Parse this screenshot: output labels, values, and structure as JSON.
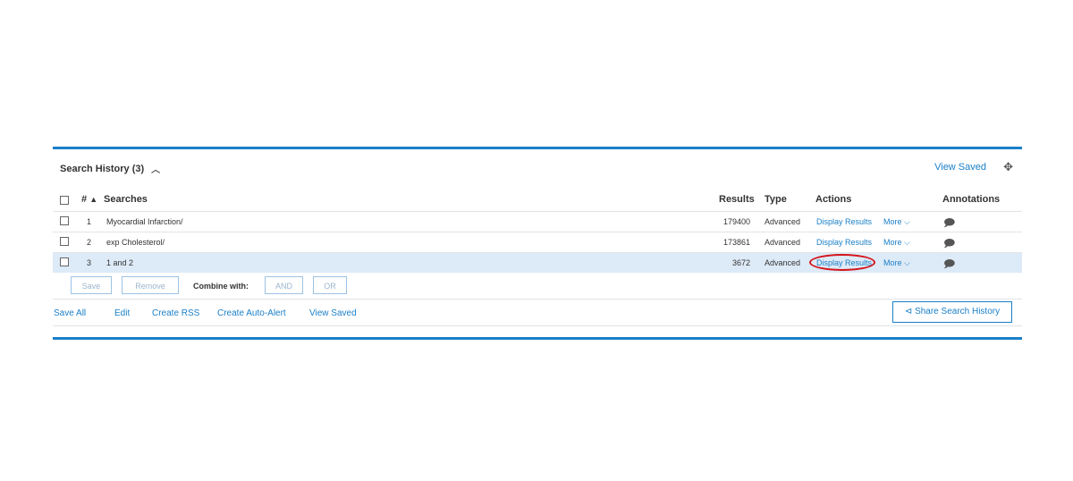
{
  "header": {
    "title": "Search History (3)",
    "caret_icon": "chevron-up-icon",
    "view_saved": "View Saved",
    "move_icon": "move-icon"
  },
  "columns": {
    "num": "#",
    "sort_glyph": "▲",
    "searches": "Searches",
    "results": "Results",
    "type": "Type",
    "actions": "Actions",
    "annotations": "Annotations"
  },
  "rows": [
    {
      "num": "1",
      "search": "Myocardial Infarction/",
      "results": "179400",
      "type": "Advanced",
      "display": "Display Results",
      "more": "More ⌵",
      "annotation_icon": "comment-icon"
    },
    {
      "num": "2",
      "search": "exp Cholesterol/",
      "results": "173861",
      "type": "Advanced",
      "display": "Display Results",
      "more": "More ⌵",
      "annotation_icon": "comment-icon"
    },
    {
      "num": "3",
      "search": "1 and 2",
      "results": "3672",
      "type": "Advanced",
      "display": "Display Results",
      "more": "More ⌵",
      "annotation_icon": "comment-icon"
    }
  ],
  "toolbar": {
    "save": "Save",
    "remove": "Remove",
    "combine_with": "Combine with:",
    "and": "AND",
    "or": "OR"
  },
  "footer": {
    "save_all": "Save All",
    "edit": "Edit",
    "create_rss": "Create RSS",
    "create_auto_alert": "Create Auto-Alert",
    "view_saved": "View Saved",
    "share": "Share Search History",
    "share_icon": "share-icon"
  },
  "colors": {
    "accent": "#1a7fc8",
    "selected_row": "#ddeaf7",
    "highlight_circle": "#d4141c"
  }
}
